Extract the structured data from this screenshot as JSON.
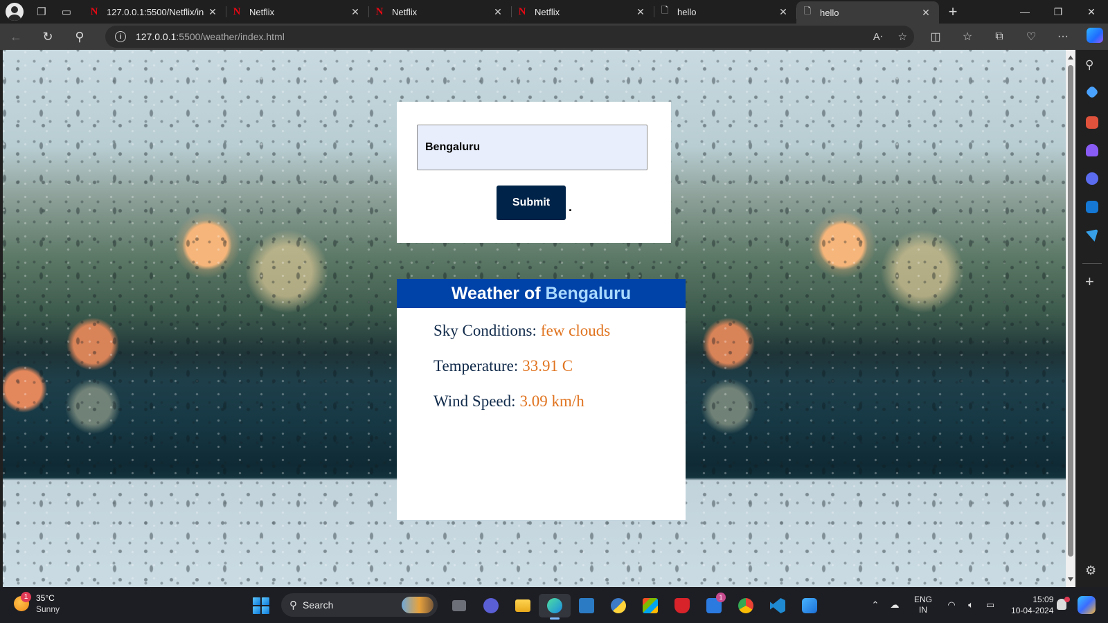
{
  "browser": {
    "tabs": [
      {
        "title": "127.0.0.1:5500/Netflix/in",
        "favicon": "netflix-icon"
      },
      {
        "title": "Netflix",
        "favicon": "netflix-icon"
      },
      {
        "title": "Netflix",
        "favicon": "netflix-icon"
      },
      {
        "title": "Netflix",
        "favicon": "netflix-icon"
      },
      {
        "title": "hello",
        "favicon": "document-icon"
      },
      {
        "title": "hello",
        "favicon": "document-icon",
        "active": true
      }
    ],
    "url_host": "127.0.0.1",
    "url_path": ":5500/weather/index.html"
  },
  "page": {
    "search": {
      "value": "Bengaluru",
      "submit_label": "Submit",
      "trailing_dot": "."
    },
    "result": {
      "heading_prefix": "Weather of",
      "heading_city": "Bengaluru",
      "sky_label": "Sky Conditions:",
      "sky_value": "few clouds",
      "temp_label": "Temperature:",
      "temp_value": "33.91 C",
      "wind_label": "Wind Speed:",
      "wind_value": "3.09 km/h"
    },
    "colors": {
      "header_bar": "#0043a8",
      "city_highlight": "#a9d9ff",
      "value_text": "#e0731f",
      "submit_button": "#002449"
    }
  },
  "taskbar": {
    "weather_temp": "35°C",
    "weather_condition": "Sunny",
    "weather_badge": "1",
    "search_label": "Search",
    "teams_badge": "1",
    "lang_1": "ENG",
    "lang_2": "IN",
    "time": "15:09",
    "date": "10-04-2024"
  }
}
